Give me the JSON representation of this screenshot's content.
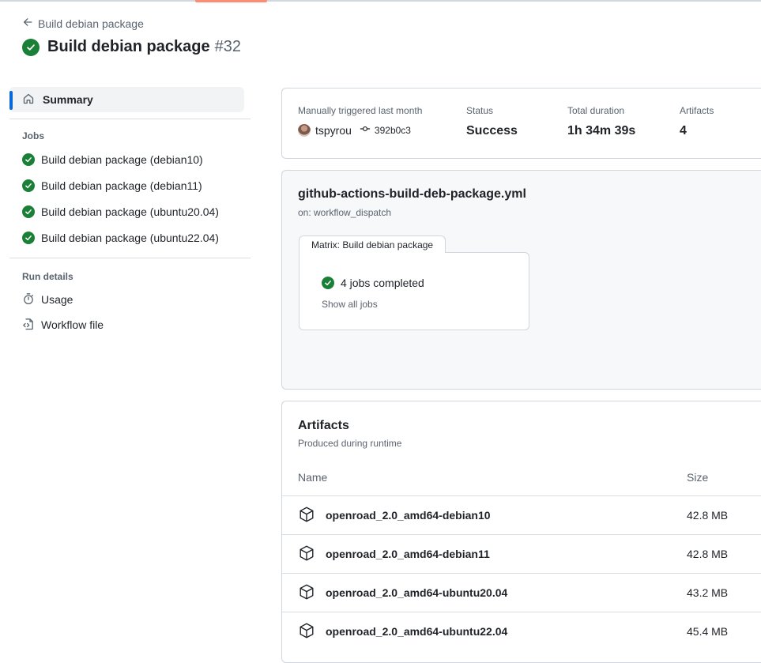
{
  "header": {
    "back_label": "Build debian package",
    "title": "Build debian package",
    "run_number": "#32"
  },
  "sidebar": {
    "summary_label": "Summary",
    "jobs_heading": "Jobs",
    "jobs": [
      {
        "label": "Build debian package (debian10)",
        "status": "success"
      },
      {
        "label": "Build debian package (debian11)",
        "status": "success"
      },
      {
        "label": "Build debian package (ubuntu20.04)",
        "status": "success"
      },
      {
        "label": "Build debian package (ubuntu22.04)",
        "status": "success"
      }
    ],
    "run_details_heading": "Run details",
    "usage_label": "Usage",
    "workflow_file_label": "Workflow file"
  },
  "summary": {
    "trigger_label": "Manually triggered last month",
    "actor": "tspyrou",
    "commit": "392b0c3",
    "status_label": "Status",
    "status_value": "Success",
    "duration_label": "Total duration",
    "duration_value": "1h 34m 39s",
    "artifacts_label": "Artifacts",
    "artifacts_count": "4"
  },
  "workflow": {
    "file": "github-actions-build-deb-package.yml",
    "trigger": "on: workflow_dispatch",
    "matrix_label": "Matrix: Build debian package",
    "jobs_completed": "4 jobs completed",
    "show_all": "Show all jobs"
  },
  "artifacts": {
    "title": "Artifacts",
    "subtitle": "Produced during runtime",
    "col_name": "Name",
    "col_size": "Size",
    "rows": [
      {
        "name": "openroad_2.0_amd64-debian10",
        "size": "42.8 MB"
      },
      {
        "name": "openroad_2.0_amd64-debian11",
        "size": "42.8 MB"
      },
      {
        "name": "openroad_2.0_amd64-ubuntu20.04",
        "size": "43.2 MB"
      },
      {
        "name": "openroad_2.0_amd64-ubuntu22.04",
        "size": "45.4 MB"
      }
    ]
  },
  "colors": {
    "success": "#1a7f37",
    "accent": "#0969da",
    "tab_underline": "#fd8c73",
    "muted_text": "#59636e",
    "border": "#d0d7de"
  }
}
